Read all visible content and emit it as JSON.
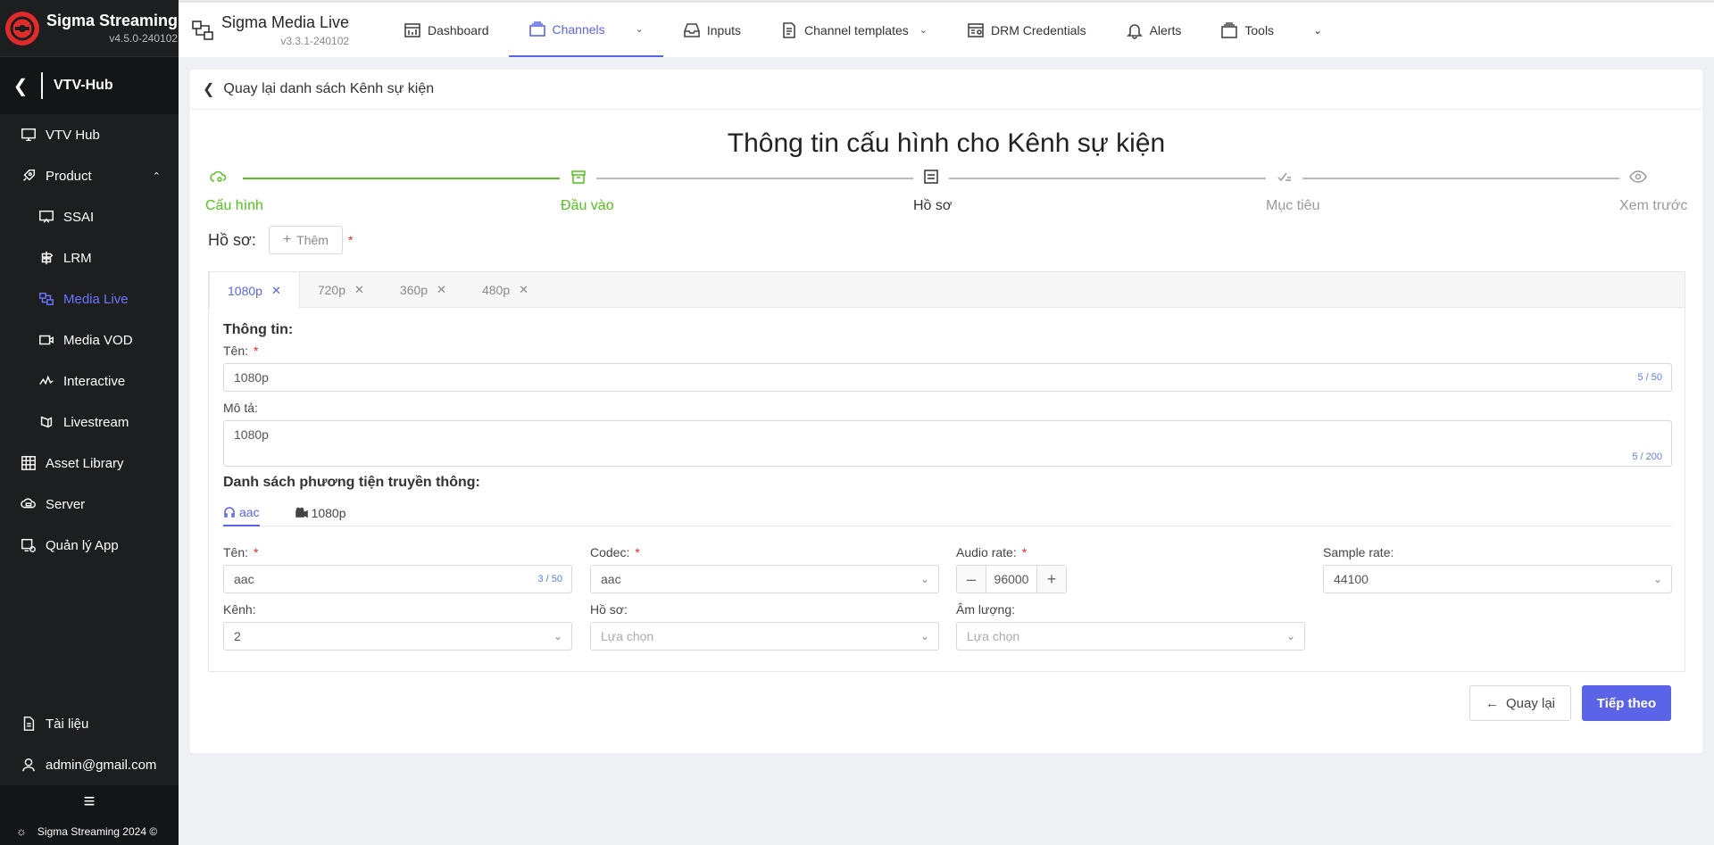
{
  "sidebar": {
    "brand_name": "Sigma Streaming",
    "brand_version": "v4.5.0-240102",
    "hub_title": "VTV-Hub",
    "items": [
      {
        "label": "VTV Hub",
        "icon": "monitor-icon"
      },
      {
        "label": "Product",
        "icon": "rocket-icon"
      },
      {
        "label": "SSAI",
        "icon": "screen-cast-icon"
      },
      {
        "label": "LRM",
        "icon": "signpost-icon"
      },
      {
        "label": "Media Live",
        "icon": "live-stream-icon"
      },
      {
        "label": "Media VOD",
        "icon": "video-icon"
      },
      {
        "label": "Interactive",
        "icon": "activity-icon"
      },
      {
        "label": "Livestream",
        "icon": "livestream-icon"
      },
      {
        "label": "Asset Library",
        "icon": "grid-icon"
      },
      {
        "label": "Server",
        "icon": "cloud-server-icon"
      },
      {
        "label": "Quản lý App",
        "icon": "app-settings-icon"
      }
    ],
    "bottom": [
      {
        "label": "Tài liệu",
        "icon": "document-icon"
      },
      {
        "label": "admin@gmail.com",
        "icon": "user-icon"
      }
    ],
    "footer": "Sigma Streaming 2024 ©"
  },
  "topbar": {
    "app_name": "Sigma Media Live",
    "app_version": "v3.3.1-240102",
    "menu": [
      {
        "label": "Dashboard",
        "icon": "dashboard-icon"
      },
      {
        "label": "Channels",
        "icon": "channels-icon"
      },
      {
        "label": "Inputs",
        "icon": "inbox-icon"
      },
      {
        "label": "Channel templates",
        "icon": "file-icon"
      },
      {
        "label": "DRM Credentials",
        "icon": "credentials-icon"
      },
      {
        "label": "Alerts",
        "icon": "bell-icon"
      },
      {
        "label": "Tools",
        "icon": "tools-icon"
      }
    ]
  },
  "page": {
    "back_label": "Quay lại danh sách Kênh sự kiện",
    "title": "Thông tin cấu hình cho Kênh sự kiện",
    "steps": [
      "Cấu hình",
      "Đầu vào",
      "Hồ sơ",
      "Mục tiêu",
      "Xem trước"
    ],
    "current_step": 3,
    "profile_label": "Hồ sơ:",
    "add_label": "Thêm",
    "profile_tabs": [
      "1080p",
      "720p",
      "360p",
      "480p"
    ],
    "info_heading": "Thông tin:",
    "name_label": "Tên:",
    "name_value": "1080p",
    "name_count": "5 / 50",
    "desc_label": "Mô tả:",
    "desc_value": "1080p",
    "desc_count": "5 / 200",
    "media_heading": "Danh sách phương tiện truyền thông:",
    "media_tabs": [
      "aac",
      "1080p"
    ],
    "fields": {
      "ten_label": "Tên:",
      "ten_value": "aac",
      "ten_count": "3 / 50",
      "codec_label": "Codec:",
      "codec_value": "aac",
      "audio_rate_label": "Audio rate:",
      "audio_rate_value": "96000",
      "sample_rate_label": "Sample rate:",
      "sample_rate_value": "44100",
      "kenh_label": "Kênh:",
      "kenh_value": "2",
      "hoso_label": "Hồ sơ:",
      "hoso_placeholder": "Lựa chọn",
      "amluong_label": "Âm lượng:",
      "amluong_placeholder": "Lựa chọn"
    },
    "btn_back": "Quay lại",
    "btn_next": "Tiếp theo"
  },
  "colors": {
    "accent": "#5b63e6",
    "done": "#52c41a",
    "sidebar": "#1d1e20"
  }
}
